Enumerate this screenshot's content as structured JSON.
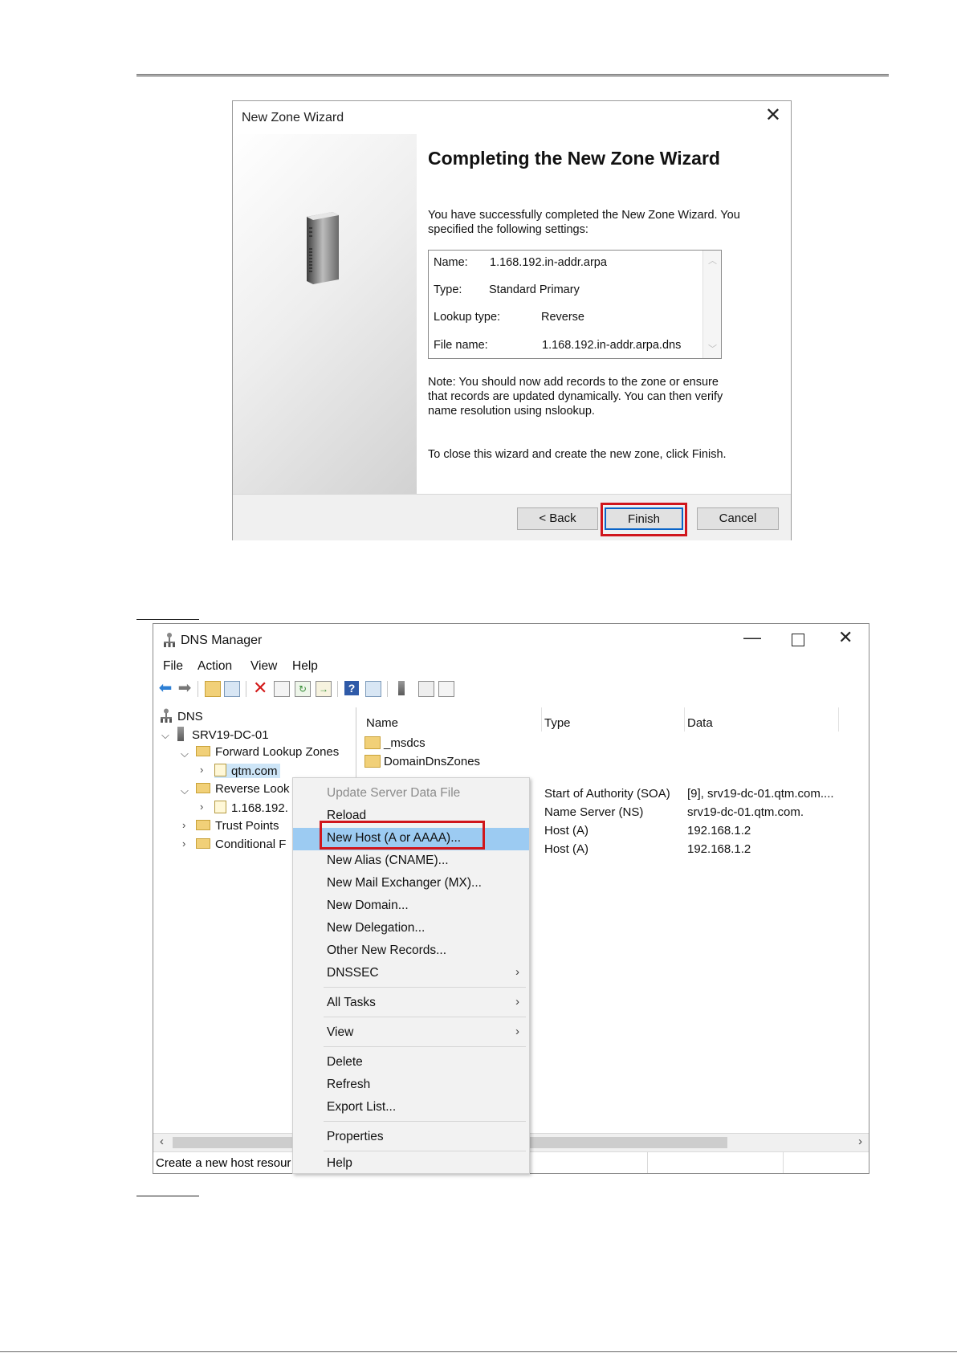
{
  "wizard": {
    "window_title": "New Zone Wizard",
    "heading": "Completing the New Zone Wizard",
    "intro": [
      "You have successfully completed the New Zone Wizard. You",
      "specified the following settings:"
    ],
    "settings": [
      {
        "label": "Name:",
        "value": "1.168.192.in-addr.arpa"
      },
      {
        "label": "Type:",
        "value": "Standard Primary"
      },
      {
        "label": "Lookup type:",
        "value": "Reverse"
      },
      {
        "label": "File name:",
        "value": "1.168.192.in-addr.arpa.dns"
      }
    ],
    "note": [
      "Note: You should now add records to the zone or ensure",
      "that records are updated dynamically. You can then verify",
      "name resolution using nslookup."
    ],
    "closing": "To close this wizard and create the new zone, click Finish.",
    "buttons": {
      "back": "< Back",
      "finish": "Finish",
      "cancel": "Cancel"
    }
  },
  "dns_manager": {
    "window_title": "DNS Manager",
    "menu": [
      "File",
      "Action",
      "View",
      "Help"
    ],
    "tree": {
      "root": "DNS",
      "server": "SRV19-DC-01",
      "forward_zones": "Forward Lookup Zones",
      "forward_child": "qtm.com",
      "reverse_zones": "Reverse Look",
      "reverse_child": "1.168.192.",
      "trust_points": "Trust Points",
      "conditional": "Conditional F"
    },
    "columns": [
      "Name",
      "Type",
      "Data"
    ],
    "rows": [
      {
        "name": "_msdcs",
        "type": "",
        "data": ""
      },
      {
        "name": "DomainDnsZones",
        "type": "",
        "data": ""
      },
      {
        "name": "",
        "type": "Start of Authority (SOA)",
        "data": "[9], srv19-dc-01.qtm.com...."
      },
      {
        "name": "",
        "type": "Name Server (NS)",
        "data": "srv19-dc-01.qtm.com."
      },
      {
        "name": "",
        "type": "Host (A)",
        "data": "192.168.1.2"
      },
      {
        "name": "",
        "type": "Host (A)",
        "data": "192.168.1.2"
      }
    ],
    "status_text": "Create a new host resour",
    "context_menu": [
      {
        "label": "Update Server Data File",
        "disabled": true
      },
      {
        "label": "Reload"
      },
      {
        "label": "New Host (A or AAAA)...",
        "highlighted": true
      },
      {
        "label": "New Alias (CNAME)..."
      },
      {
        "label": "New Mail Exchanger (MX)..."
      },
      {
        "label": "New Domain..."
      },
      {
        "label": "New Delegation..."
      },
      {
        "label": "Other New Records..."
      },
      {
        "label": "DNSSEC",
        "submenu": true
      },
      {
        "label": "All Tasks",
        "submenu": true
      },
      {
        "label": "View",
        "submenu": true
      },
      {
        "label": "Delete"
      },
      {
        "label": "Refresh"
      },
      {
        "label": "Export List..."
      },
      {
        "label": "Properties"
      },
      {
        "label": "Help"
      }
    ]
  },
  "colors": {
    "highlight_box": "#d0161c",
    "menu_highlight": "#9ccbf2",
    "primary_button_border": "#0a64c8"
  }
}
